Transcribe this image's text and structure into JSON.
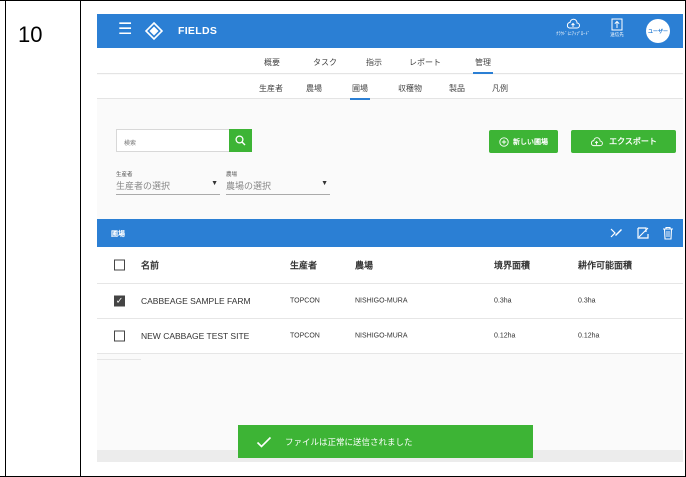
{
  "document": {
    "step_number": "10"
  },
  "app": {
    "title": "FIELDS",
    "header": {
      "upload_label": "ｸﾗｳﾄﾞにｱｯﾌﾟﾛｰﾄﾞ",
      "sent_label": "送信先",
      "avatar_text": "ユーザー"
    },
    "primary_tabs": [
      {
        "label": "概要"
      },
      {
        "label": "タスク"
      },
      {
        "label": "指示"
      },
      {
        "label": "レポート"
      },
      {
        "label": "管理",
        "active": true
      }
    ],
    "secondary_tabs": [
      {
        "label": "生産者"
      },
      {
        "label": "農場"
      },
      {
        "label": "圃場",
        "active": true
      },
      {
        "label": "収穫物"
      },
      {
        "label": "製品"
      },
      {
        "label": "凡例"
      }
    ],
    "search": {
      "placeholder": "検索"
    },
    "buttons": {
      "new_field": "新しい圃場",
      "export": "エクスポート"
    },
    "filters": {
      "producer": {
        "label": "生産者",
        "placeholder": "生産者の選択"
      },
      "farm": {
        "label": "農場",
        "placeholder": "農場の選択"
      }
    },
    "panel": {
      "title": "圃場"
    },
    "table": {
      "columns": [
        "名前",
        "生産者",
        "農場",
        "境界面積",
        "耕作可能面積"
      ],
      "rows": [
        {
          "checked": true,
          "name": "CABBEAGE SAMPLE FARM",
          "producer": "TOPCON",
          "farm": "NISHIGO-MURA",
          "boundary_area": "0.3ha",
          "arable_area": "0.3ha"
        },
        {
          "checked": false,
          "name": "NEW CABBAGE TEST SITE",
          "producer": "TOPCON",
          "farm": "NISHIGO-MURA",
          "boundary_area": "0.12ha",
          "arable_area": "0.12ha"
        }
      ]
    },
    "toast": {
      "message": "ファイルは正常に送信されました"
    },
    "colors": {
      "primary_blue": "#2b7fd4",
      "action_green": "#3db435"
    }
  }
}
